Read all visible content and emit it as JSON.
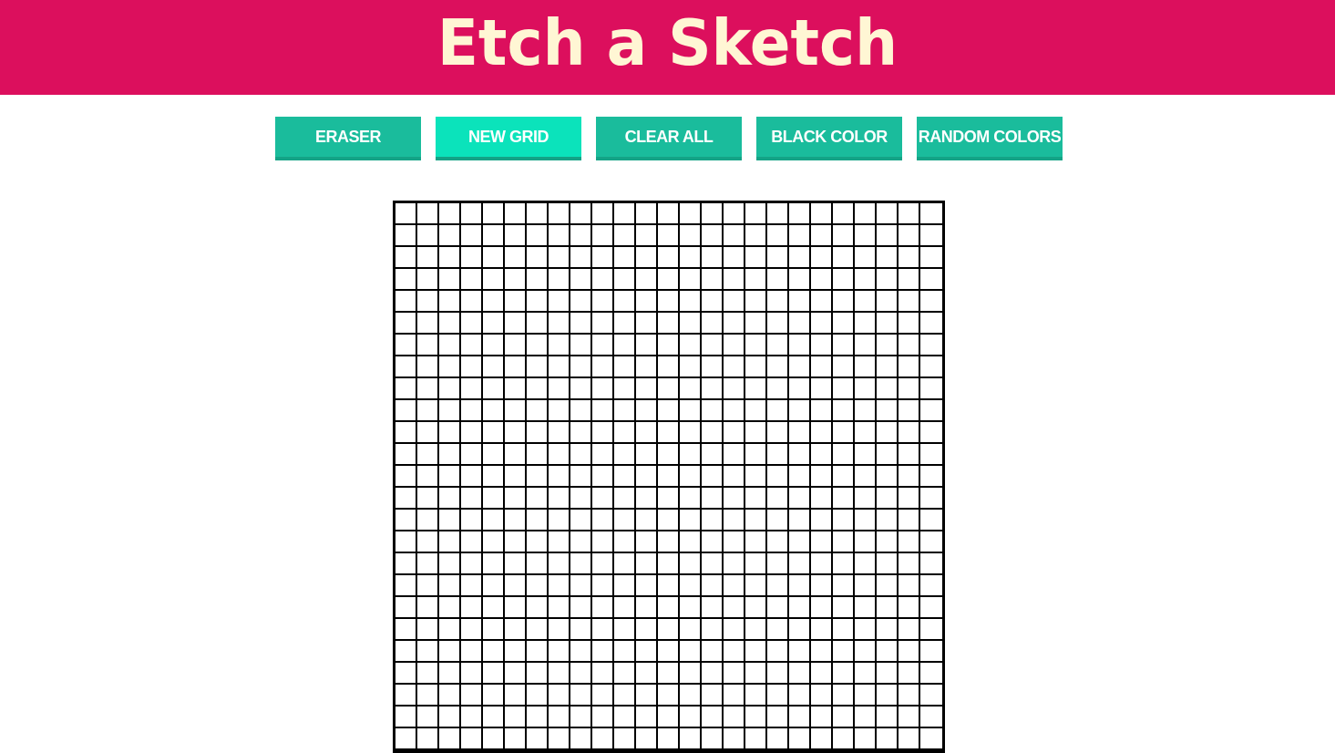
{
  "header": {
    "title": "Etch a Sketch",
    "background": "#dc0f5d",
    "title_color": "#fff6d4"
  },
  "toolbar": {
    "buttons": [
      {
        "id": "eraser",
        "label": "ERASER",
        "active": false
      },
      {
        "id": "new-grid",
        "label": "NEW GRID",
        "active": true
      },
      {
        "id": "clear-all",
        "label": "CLEAR ALL",
        "active": false
      },
      {
        "id": "black-color",
        "label": "BLACK COLOR",
        "active": false
      },
      {
        "id": "random-colors",
        "label": "RANDOM COLORS",
        "active": false
      }
    ],
    "button_color": "#1abc9c",
    "active_button_color": "#0be3bb"
  },
  "grid": {
    "columns": 25,
    "rows": 25,
    "cell_color": "#ffffff",
    "line_color": "#000000"
  }
}
